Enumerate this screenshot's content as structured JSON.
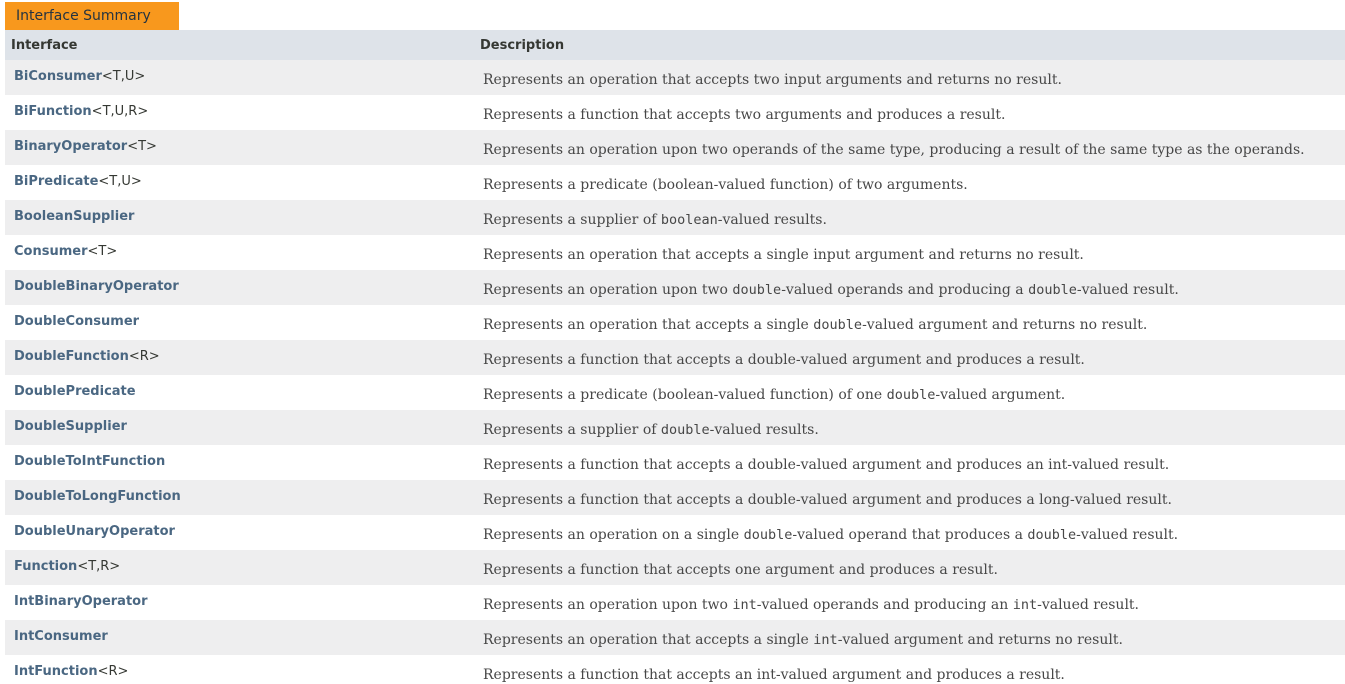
{
  "caption": "Interface Summary",
  "columns": {
    "interface": "Interface",
    "description": "Description"
  },
  "rows": [
    {
      "name": "BiConsumer",
      "generic": "<T,U>",
      "desc": [
        {
          "t": "Represents an operation that accepts two input arguments and returns no result."
        }
      ]
    },
    {
      "name": "BiFunction",
      "generic": "<T,U,R>",
      "desc": [
        {
          "t": "Represents a function that accepts two arguments and produces a result."
        }
      ]
    },
    {
      "name": "BinaryOperator",
      "generic": "<T>",
      "desc": [
        {
          "t": "Represents an operation upon two operands of the same type, producing a result of the same type as the operands."
        }
      ]
    },
    {
      "name": "BiPredicate",
      "generic": "<T,U>",
      "desc": [
        {
          "t": "Represents a predicate (boolean-valued function) of two arguments."
        }
      ]
    },
    {
      "name": "BooleanSupplier",
      "generic": "",
      "desc": [
        {
          "t": "Represents a supplier of "
        },
        {
          "t": "boolean",
          "code": true
        },
        {
          "t": "-valued results."
        }
      ]
    },
    {
      "name": "Consumer",
      "generic": "<T>",
      "desc": [
        {
          "t": "Represents an operation that accepts a single input argument and returns no result."
        }
      ]
    },
    {
      "name": "DoubleBinaryOperator",
      "generic": "",
      "desc": [
        {
          "t": "Represents an operation upon two "
        },
        {
          "t": "double",
          "code": true
        },
        {
          "t": "-valued operands and producing a "
        },
        {
          "t": "double",
          "code": true
        },
        {
          "t": "-valued result."
        }
      ]
    },
    {
      "name": "DoubleConsumer",
      "generic": "",
      "desc": [
        {
          "t": "Represents an operation that accepts a single "
        },
        {
          "t": "double",
          "code": true
        },
        {
          "t": "-valued argument and returns no result."
        }
      ]
    },
    {
      "name": "DoubleFunction",
      "generic": "<R>",
      "desc": [
        {
          "t": "Represents a function that accepts a double-valued argument and produces a result."
        }
      ]
    },
    {
      "name": "DoublePredicate",
      "generic": "",
      "desc": [
        {
          "t": "Represents a predicate (boolean-valued function) of one "
        },
        {
          "t": "double",
          "code": true
        },
        {
          "t": "-valued argument."
        }
      ]
    },
    {
      "name": "DoubleSupplier",
      "generic": "",
      "desc": [
        {
          "t": "Represents a supplier of "
        },
        {
          "t": "double",
          "code": true
        },
        {
          "t": "-valued results."
        }
      ]
    },
    {
      "name": "DoubleToIntFunction",
      "generic": "",
      "desc": [
        {
          "t": "Represents a function that accepts a double-valued argument and produces an int-valued result."
        }
      ]
    },
    {
      "name": "DoubleToLongFunction",
      "generic": "",
      "desc": [
        {
          "t": "Represents a function that accepts a double-valued argument and produces a long-valued result."
        }
      ]
    },
    {
      "name": "DoubleUnaryOperator",
      "generic": "",
      "desc": [
        {
          "t": "Represents an operation on a single "
        },
        {
          "t": "double",
          "code": true
        },
        {
          "t": "-valued operand that produces a "
        },
        {
          "t": "double",
          "code": true
        },
        {
          "t": "-valued result."
        }
      ]
    },
    {
      "name": "Function",
      "generic": "<T,R>",
      "desc": [
        {
          "t": "Represents a function that accepts one argument and produces a result."
        }
      ]
    },
    {
      "name": "IntBinaryOperator",
      "generic": "",
      "desc": [
        {
          "t": "Represents an operation upon two "
        },
        {
          "t": "int",
          "code": true
        },
        {
          "t": "-valued operands and producing an "
        },
        {
          "t": "int",
          "code": true
        },
        {
          "t": "-valued result."
        }
      ]
    },
    {
      "name": "IntConsumer",
      "generic": "",
      "desc": [
        {
          "t": "Represents an operation that accepts a single "
        },
        {
          "t": "int",
          "code": true
        },
        {
          "t": "-valued argument and returns no result."
        }
      ]
    },
    {
      "name": "IntFunction",
      "generic": "<R>",
      "desc": [
        {
          "t": "Represents a function that accepts an int-valued argument and produces a result."
        }
      ]
    }
  ]
}
